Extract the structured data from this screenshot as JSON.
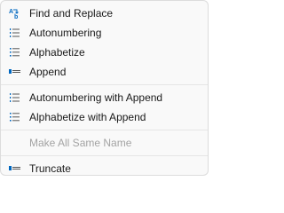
{
  "menu": {
    "groups": [
      {
        "items": [
          {
            "label": "Find and Replace",
            "icon": "find-replace-icon",
            "enabled": true
          },
          {
            "label": "Autonumbering",
            "icon": "numbered-list-icon",
            "enabled": true
          },
          {
            "label": "Alphabetize",
            "icon": "alphabetize-icon",
            "enabled": true
          },
          {
            "label": "Append",
            "icon": "append-icon",
            "enabled": true
          }
        ]
      },
      {
        "items": [
          {
            "label": "Autonumbering with Append",
            "icon": "numbered-list-icon",
            "enabled": true
          },
          {
            "label": "Alphabetize with Append",
            "icon": "alphabetize-icon",
            "enabled": true
          }
        ]
      },
      {
        "items": [
          {
            "label": "Make All Same Name",
            "icon": "",
            "enabled": false
          }
        ]
      },
      {
        "items": [
          {
            "label": "Truncate",
            "icon": "truncate-icon",
            "enabled": true
          }
        ]
      }
    ]
  },
  "colors": {
    "icon_blue": "#0067c0",
    "text": "#1a1a1a",
    "disabled_text": "#a3a3a3",
    "background": "#f9f9f9"
  }
}
